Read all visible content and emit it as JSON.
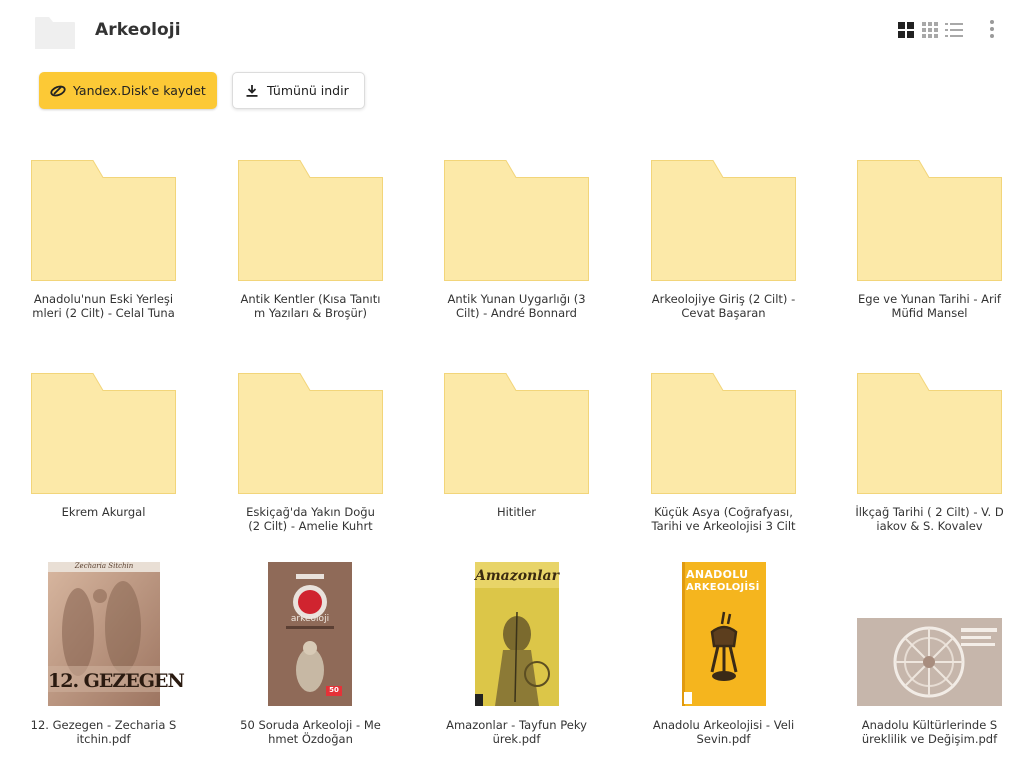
{
  "header": {
    "title": "Arkeoloji",
    "view_icons": [
      "large-grid-icon",
      "small-grid-icon",
      "list-icon"
    ],
    "more_icon": "more-vertical-icon"
  },
  "actions": {
    "save_label": "Yandex.Disk'e kaydet",
    "download_label": "Tümünü indir"
  },
  "colors": {
    "accent": "#fcc936",
    "folder_fill": "#fce9a8",
    "folder_stroke": "#f2d57a"
  },
  "items": [
    {
      "name": "Anadolu'nun Eski Yerleşi mleri (2 Cilt) - Celal Tuna",
      "line1": "Anadolu'nun Eski Yerleşi",
      "line2": "mleri (2 Cilt) - Celal Tuna",
      "type": "folder"
    },
    {
      "name": "Antik Kentler (Kısa Tanıtı m Yazıları & Broşür)",
      "line1": "Antik Kentler (Kısa Tanıtı",
      "line2": "m Yazıları & Broşür)",
      "type": "folder"
    },
    {
      "name": "Antik Yunan Uygarlığı (3 Cilt) - André Bonnard",
      "line1": "Antik Yunan Uygarlığı (3",
      "line2": "Cilt) - André Bonnard",
      "type": "folder"
    },
    {
      "name": "Arkeolojiye Giriş (2 Cilt) - Cevat Başaran",
      "line1": "Arkeolojiye Giriş (2 Cilt) -",
      "line2": "Cevat Başaran",
      "type": "folder"
    },
    {
      "name": "Ege ve Yunan Tarihi - Arif Müfid Mansel",
      "line1": "Ege ve Yunan Tarihi - Arif",
      "line2": "Müfid Mansel",
      "type": "folder"
    },
    {
      "name": "Ekrem Akurgal",
      "line1": "Ekrem Akurgal",
      "line2": "",
      "type": "folder"
    },
    {
      "name": "Eskiçağ'da Yakın Doğu (2 Cilt) - Amelie Kuhrt",
      "line1": "Eskiçağ'da Yakın Doğu",
      "line2": "(2 Cilt) - Amelie Kuhrt",
      "type": "folder"
    },
    {
      "name": "Hititler",
      "line1": "Hititler",
      "line2": "",
      "type": "folder"
    },
    {
      "name": "Küçük Asya (Coğrafyası, Tarihi ve Arkeolojisi 3 Cilt",
      "line1": "Küçük Asya (Coğrafyası,",
      "line2": "Tarihi ve Arkeolojisi 3 Cilt",
      "type": "folder"
    },
    {
      "name": "İlkçağ Tarihi ( 2 Cilt) - V. D iakov & S. Kovalev",
      "line1": "İlkçağ Tarihi ( 2 Cilt) - V. D",
      "line2": "iakov & S. Kovalev",
      "type": "folder"
    },
    {
      "name": "12. Gezegen - Zecharia S itchin.pdf",
      "line1": "12. Gezegen - Zecharia S",
      "line2": "itchin.pdf",
      "type": "pdf",
      "cover_text": "12. GEZEGEN",
      "cover_author": "Zecharia Sitchin"
    },
    {
      "name": "50 Soruda Arkeoloji - Me hmet Özdoğan",
      "line1": "50 Soruda Arkeoloji - Me",
      "line2": "hmet Özdoğan",
      "type": "pdf",
      "cover_text": "arkeoloji",
      "cover_num": "50"
    },
    {
      "name": "Amazonlar - Tayfun Peky ürek.pdf",
      "line1": "Amazonlar - Tayfun Peky",
      "line2": "ürek.pdf",
      "type": "pdf",
      "cover_text": "Amazonlar"
    },
    {
      "name": "Anadolu Arkeolojisi - Veli Sevin.pdf",
      "line1": "Anadolu Arkeolojisi - Veli",
      "line2": "Sevin.pdf",
      "type": "pdf",
      "cover_text1": "ANADOLU",
      "cover_text2": "ARKEOLOJİSİ"
    },
    {
      "name": "Anadolu Kültürlerinde S üreklilik ve Değişim.pdf",
      "line1": "Anadolu Kültürlerinde S",
      "line2": "üreklilik ve Değişim.pdf",
      "type": "pdf"
    }
  ]
}
